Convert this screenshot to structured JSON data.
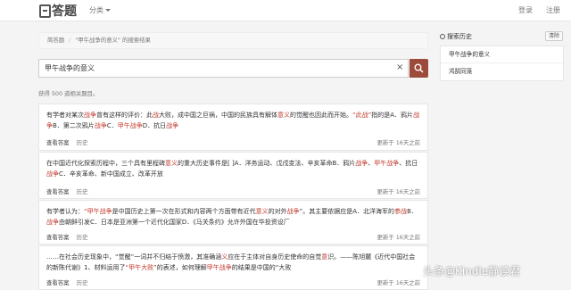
{
  "header": {
    "logo_text": "答题",
    "category_label": "分类",
    "login_label": "登录",
    "register_label": "注册"
  },
  "breadcrumb": {
    "home": "简答题",
    "current": "\"甲午战争的意义\" 的搜索结果"
  },
  "search": {
    "value": "甲午战争的意义",
    "clear_symbol": "×"
  },
  "result_count": "获得 500 道相关题目。",
  "results": [
    {
      "segments": [
        {
          "t": "有学者对某次"
        },
        {
          "t": "战争",
          "h": true
        },
        {
          "t": "曾有这样的评价：此"
        },
        {
          "t": "战",
          "h": true
        },
        {
          "t": "大败，成中国之巨祸，中国的民族具有解体"
        },
        {
          "t": "意义",
          "h": true
        },
        {
          "t": "的觉醒也因此而开始。"
        },
        {
          "t": "“此战”",
          "h": true
        },
        {
          "t": "指的是A．鸦片"
        },
        {
          "t": "战争",
          "h": true
        },
        {
          "t": "B．第二次鸦片"
        },
        {
          "t": "战争",
          "h": true
        },
        {
          "t": "C．"
        },
        {
          "t": "甲午战争",
          "h": true
        },
        {
          "t": "D．抗日"
        },
        {
          "t": "战争",
          "h": true
        }
      ],
      "answer_link": "查看答案",
      "subject": "历史",
      "time": "更新于 16天之前"
    },
    {
      "segments": [
        {
          "t": "在中国近代化探索历程中，三个具有里程碑"
        },
        {
          "t": "意义",
          "h": true
        },
        {
          "t": "的重大历史事件是[ ]A．洋务运动、戊戌变法、辛亥革命B．鸦片"
        },
        {
          "t": "战争",
          "h": true
        },
        {
          "t": "、"
        },
        {
          "t": "甲午战争",
          "h": true
        },
        {
          "t": "、抗日"
        },
        {
          "t": "战争",
          "h": true
        },
        {
          "t": "C．辛亥革命、新中国成立、改革开放"
        }
      ],
      "answer_link": "查看答案",
      "subject": "历史",
      "time": "更新于 16天之前"
    },
    {
      "segments": [
        {
          "t": "有学者认为："
        },
        {
          "t": "“甲午战争",
          "h": true
        },
        {
          "t": "是中国历史上第一次在形式和内容两个方面带有近代"
        },
        {
          "t": "意义",
          "h": true
        },
        {
          "t": "的对外"
        },
        {
          "t": "战争",
          "h": true
        },
        {
          "t": "”。其主要依据应是A．北洋海军的"
        },
        {
          "t": "参战",
          "h": true
        },
        {
          "t": "B．"
        },
        {
          "t": "战争",
          "h": true
        },
        {
          "t": "由朝鲜引发C．日本是亚洲第一个近代化国家D．《马关条约》允许外国在华投资设厂"
        }
      ],
      "answer_link": "查看答案",
      "subject": "历史",
      "time": "更新于 16天之前"
    },
    {
      "segments": [
        {
          "t": "……在社会历史现象中，“觉醒”一词并不归结于愤激，其准确涵"
        },
        {
          "t": "义",
          "h": true
        },
        {
          "t": "应在于主体对自身历史使命的自觉"
        },
        {
          "t": "意",
          "h": true
        },
        {
          "t": "识。——陈旭麓《近代中国社会的新陈代谢》1、材料运用了"
        },
        {
          "t": "“甲午大败”",
          "h": true
        },
        {
          "t": "的表述，如何理解"
        },
        {
          "t": "甲午战争",
          "h": true
        },
        {
          "t": "的结果是中国的“大败"
        }
      ],
      "answer_link": "查看答案",
      "subject": "历史",
      "time": "更新于 16天之前"
    }
  ],
  "history": {
    "title": "搜索历史",
    "clear_label": "清除",
    "items": [
      "甲午战争的意义",
      "鸿鹄同笼"
    ]
  },
  "watermark": "头条@Kindle静读君"
}
